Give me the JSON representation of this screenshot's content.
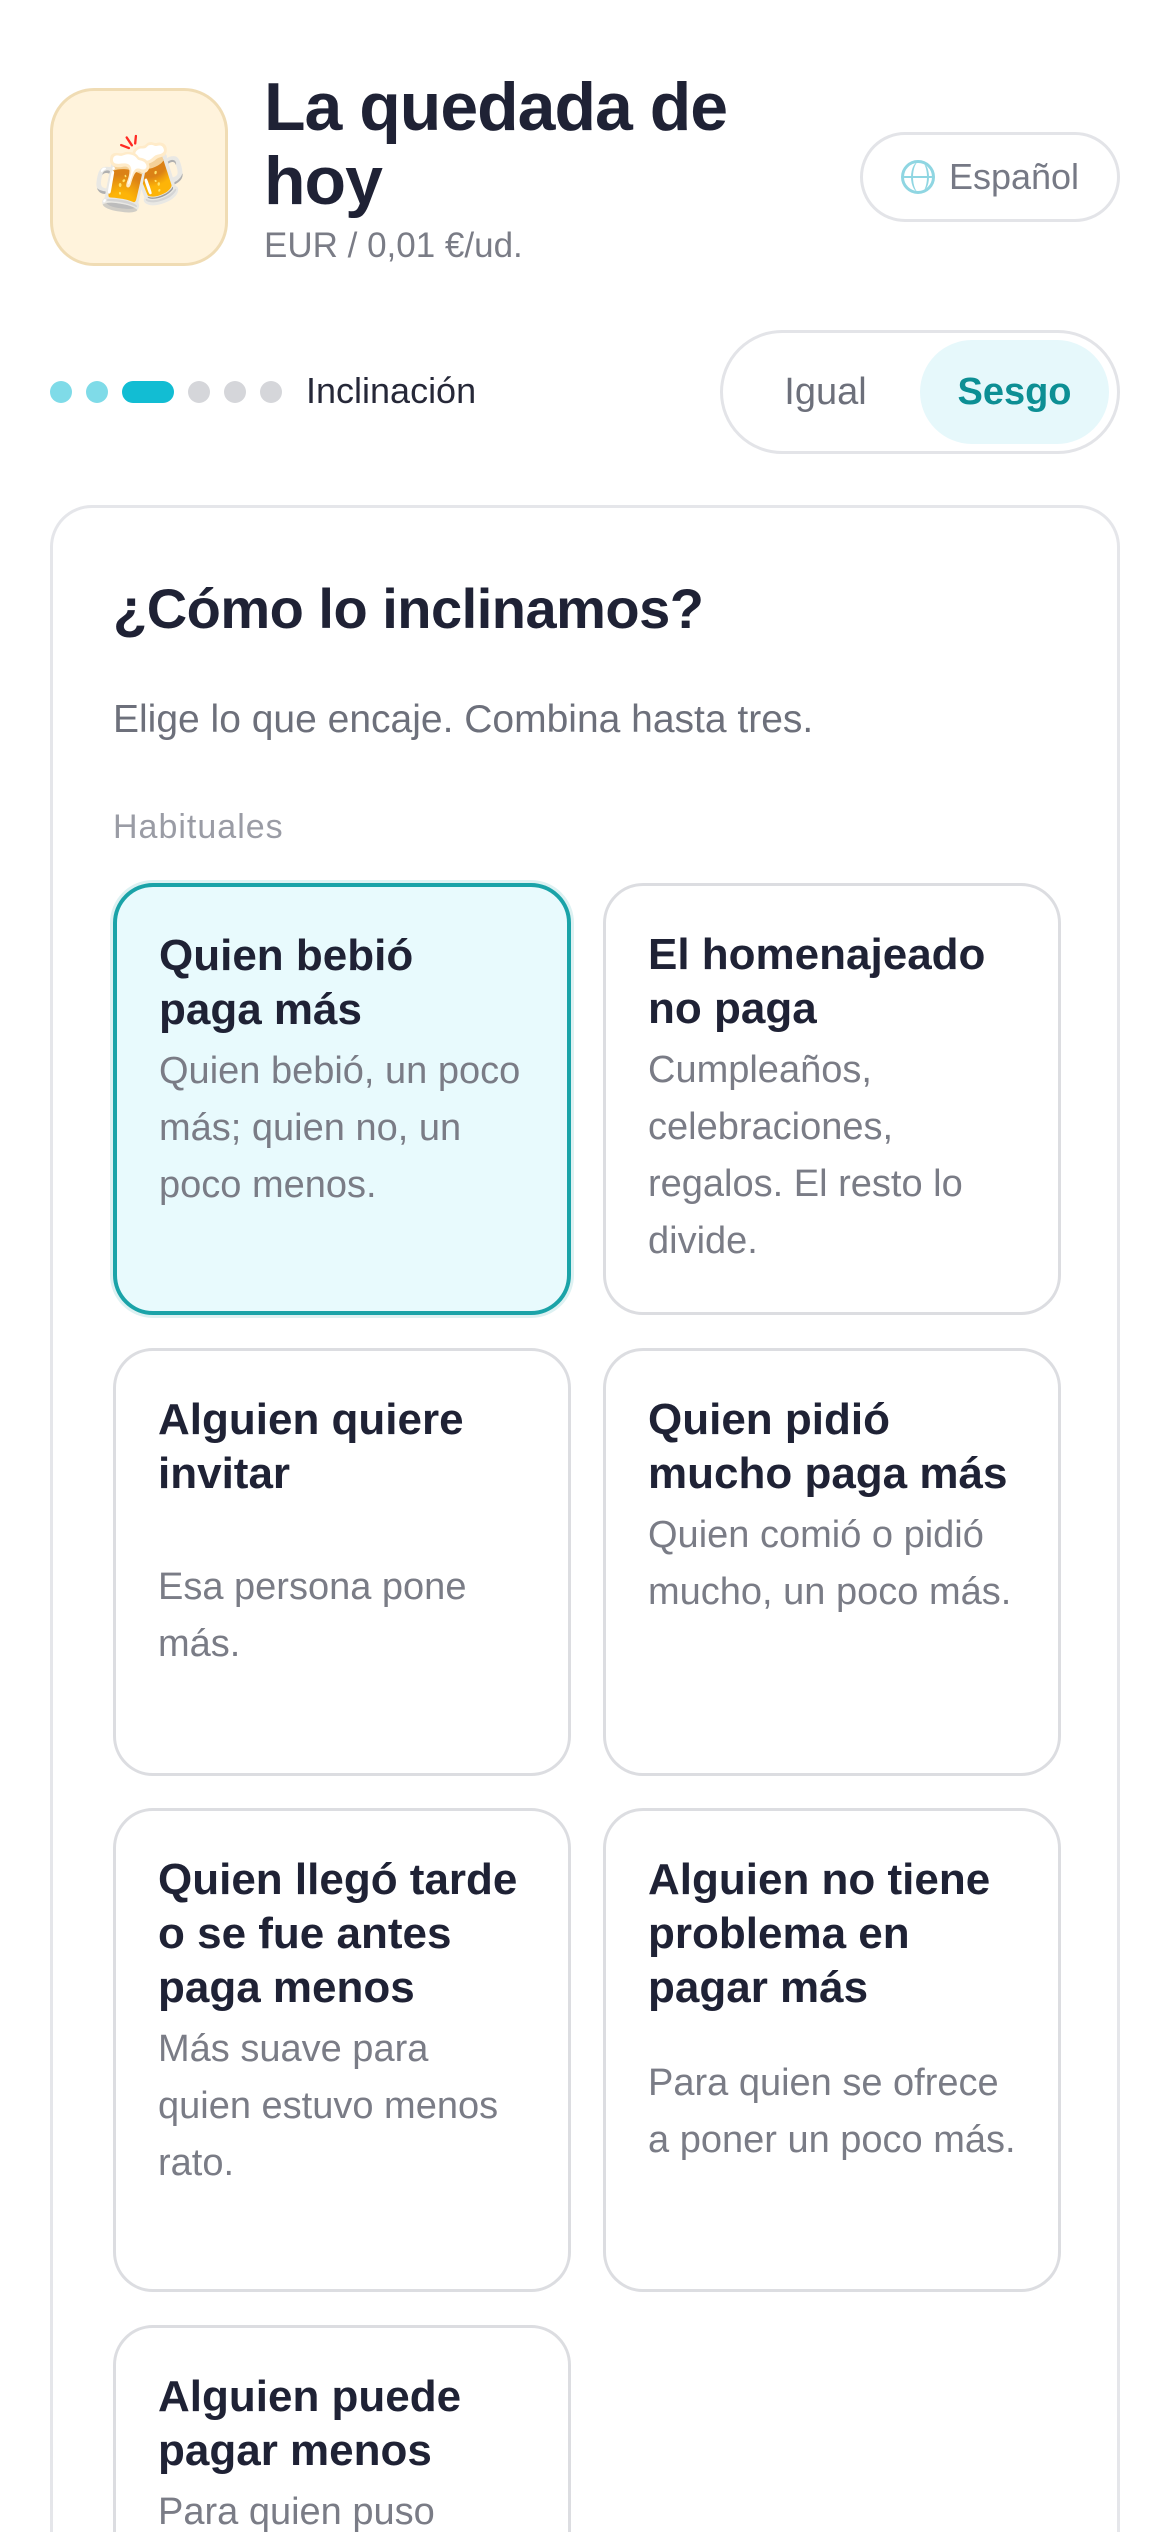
{
  "header": {
    "icon": "beer-mugs-icon",
    "icon_glyph": "🍻",
    "title": "La quedada de hoy",
    "subtitle": "EUR / 0,01 €/ud.",
    "language_label": "Español"
  },
  "progress": {
    "total_steps": 6,
    "current_step": 3,
    "step_label": "Inclinación"
  },
  "mode_toggle": {
    "options": [
      "Igual",
      "Sesgo"
    ],
    "selected": "Sesgo"
  },
  "card": {
    "title": "¿Cómo lo inclinamos?",
    "description": "Elige lo que encaje. Combina hasta tres.",
    "section_label": "Habituales",
    "options": [
      {
        "title": "Quien bebió paga más",
        "desc": "Quien bebió, un poco más; quien no, un poco menos.",
        "selected": true
      },
      {
        "title": "El homenajeado no paga",
        "desc": "Cumpleaños, celebraciones, regalos. El resto lo divide.",
        "selected": false
      },
      {
        "title": "Alguien quiere invitar",
        "desc": "Esa persona pone más.",
        "selected": false
      },
      {
        "title": "Quien pidió mucho paga más",
        "desc": "Quien comió o pidió mucho, un poco más.",
        "selected": false
      },
      {
        "title": "Quien llegó tarde o se fue antes paga menos",
        "desc": "Más suave para quien estuvo menos rato.",
        "selected": false
      },
      {
        "title": "Alguien no tiene problema en pagar más",
        "desc": "Para quien se ofrece a poner un poco más.",
        "selected": false
      },
      {
        "title": "Alguien puede pagar menos",
        "desc": "Para quien puso",
        "selected": false
      }
    ]
  },
  "colors": {
    "accent": "#12bdd3",
    "accent_dark": "#0d8f94",
    "selected_bg": "#e8fafd",
    "text_primary": "#1f2235",
    "text_secondary": "#7a7c86"
  }
}
